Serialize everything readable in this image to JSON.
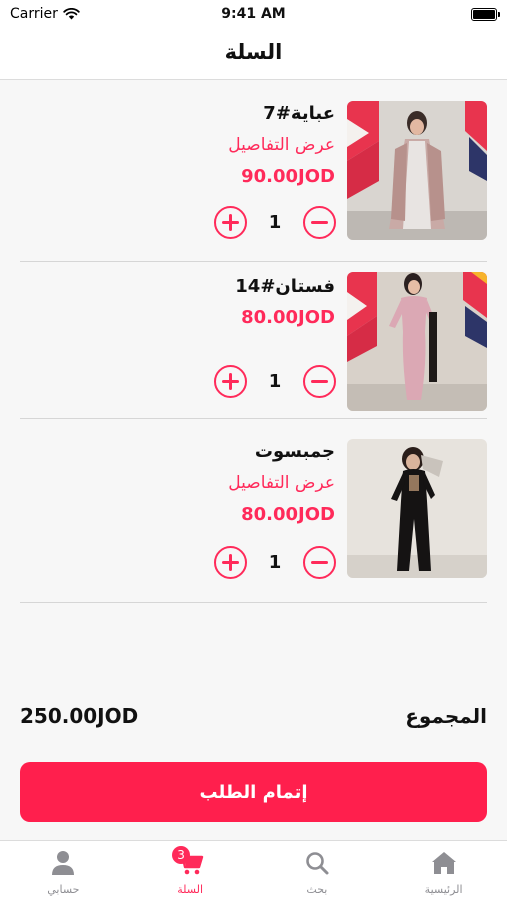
{
  "status_bar": {
    "carrier": "Carrier",
    "time": "9:41 AM"
  },
  "header": {
    "title": "السلة"
  },
  "cart": {
    "items": [
      {
        "name": "عباية#7",
        "details_link": "عرض التفاصيل",
        "price": "90.00JOD",
        "quantity": "1"
      },
      {
        "name": "فستان#14",
        "price": "80.00JOD",
        "quantity": "1"
      },
      {
        "name": "جمبسوت",
        "details_link": "عرض التفاصيل",
        "price": "80.00JOD",
        "quantity": "1"
      }
    ]
  },
  "summary": {
    "total_label": "المجموع",
    "total_value": "250.00JOD"
  },
  "checkout": {
    "label": "إتمام الطلب"
  },
  "tab_bar": {
    "tabs": [
      {
        "label": "حسابي",
        "icon": "person-icon"
      },
      {
        "label": "السلة",
        "icon": "cart-icon",
        "badge": "3",
        "active": true
      },
      {
        "label": "بحث",
        "icon": "search-icon"
      },
      {
        "label": "الرئيسية",
        "icon": "home-icon"
      }
    ]
  },
  "colors": {
    "accent": "#ff2a5a",
    "button": "#ff1f4d",
    "background": "#f7f7f7",
    "inactive": "#8e8e93"
  }
}
